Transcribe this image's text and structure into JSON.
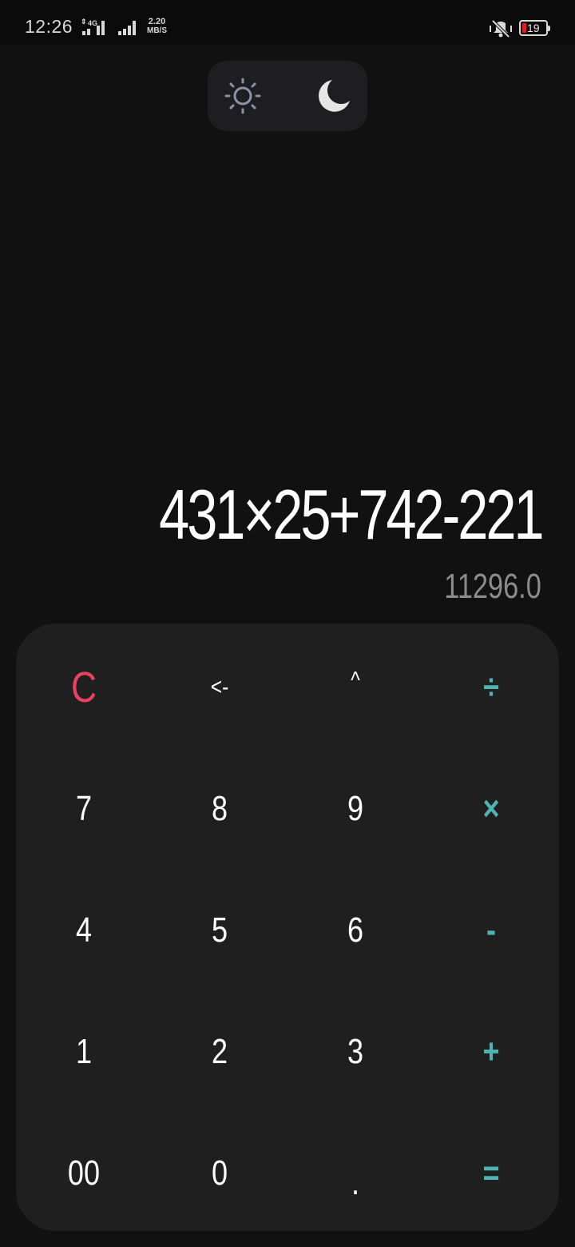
{
  "status_bar": {
    "time": "12:26",
    "network_type": "4G",
    "data_speed_value": "2.20",
    "data_speed_unit": "MB/S",
    "battery_level": "19",
    "icons": [
      "signal-icon",
      "signal-icon",
      "vibrate-silent-icon",
      "battery-icon"
    ]
  },
  "theme_toggle": {
    "light_icon": "sun-icon",
    "dark_icon": "moon-icon",
    "selected": "dark"
  },
  "display": {
    "expression": "431×25+742-221",
    "result": "11296.0"
  },
  "keypad": {
    "rows": [
      [
        {
          "label": "C",
          "type": "clear"
        },
        {
          "label": "<-",
          "type": "function"
        },
        {
          "label": "^",
          "type": "function"
        },
        {
          "label": "÷",
          "type": "operator"
        }
      ],
      [
        {
          "label": "7",
          "type": "digit"
        },
        {
          "label": "8",
          "type": "digit"
        },
        {
          "label": "9",
          "type": "digit"
        },
        {
          "label": "×",
          "type": "operator"
        }
      ],
      [
        {
          "label": "4",
          "type": "digit"
        },
        {
          "label": "5",
          "type": "digit"
        },
        {
          "label": "6",
          "type": "digit"
        },
        {
          "label": "-",
          "type": "operator"
        }
      ],
      [
        {
          "label": "1",
          "type": "digit"
        },
        {
          "label": "2",
          "type": "digit"
        },
        {
          "label": "3",
          "type": "digit"
        },
        {
          "label": "+",
          "type": "operator"
        }
      ],
      [
        {
          "label": "00",
          "type": "digit"
        },
        {
          "label": "0",
          "type": "digit"
        },
        {
          "label": ".",
          "type": "digit"
        },
        {
          "label": "=",
          "type": "operator"
        }
      ]
    ]
  },
  "colors": {
    "background": "#111112",
    "keypad_background": "#1f1f20",
    "clear_key": "#e8435c",
    "operator_key": "#4fb3b3",
    "text": "#ffffff",
    "result_text": "#8c8c8c"
  }
}
